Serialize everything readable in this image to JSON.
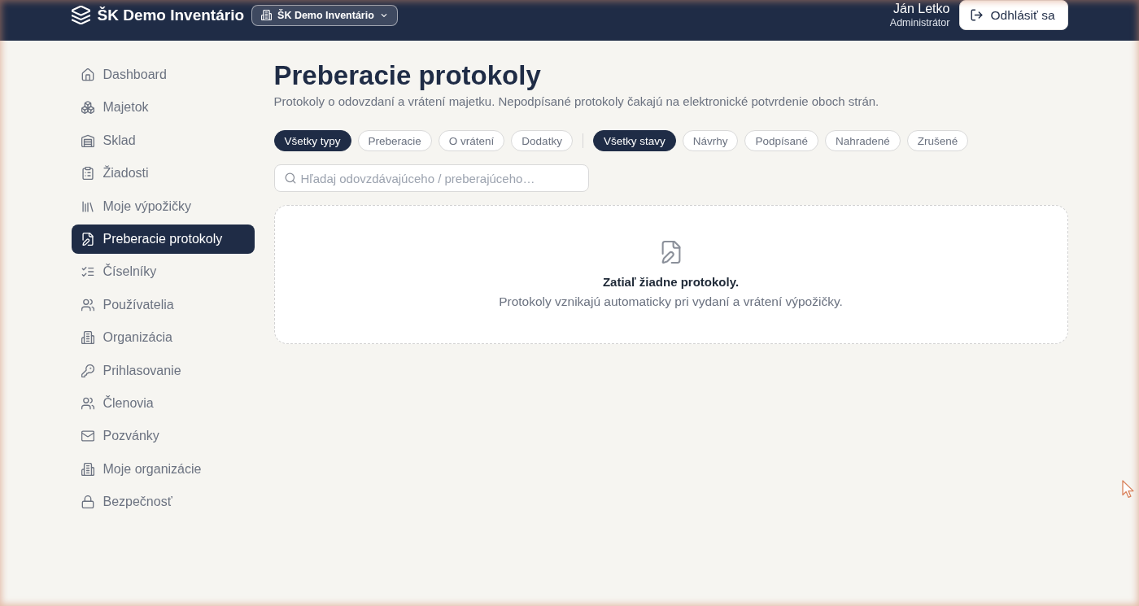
{
  "header": {
    "app_title": "ŠK Demo Inventário",
    "organization_switcher": {
      "label": "ŠK Demo Inventário"
    },
    "user": {
      "name": "Ján Letko",
      "role": "Administrátor"
    },
    "logout_button": {
      "label": "Odhlásiť sa"
    }
  },
  "sidebar": {
    "items": [
      {
        "label": "Dashboard",
        "selected": false
      },
      {
        "label": "Majetok",
        "selected": false
      },
      {
        "label": "Sklad",
        "selected": false
      },
      {
        "label": "Žiadosti",
        "selected": false
      },
      {
        "label": "Moje výpožičky",
        "selected": false
      },
      {
        "label": "Preberacie protokoly",
        "selected": true
      },
      {
        "label": "Číselníky",
        "selected": false
      },
      {
        "label": "Používatelia",
        "selected": false
      },
      {
        "label": "Organizácia",
        "selected": false
      },
      {
        "label": "Prihlasovanie",
        "selected": false
      },
      {
        "label": "Členovia",
        "selected": false
      },
      {
        "label": "Pozvánky",
        "selected": false
      },
      {
        "label": "Moje organizácie",
        "selected": false
      },
      {
        "label": "Bezpečnosť",
        "selected": false
      }
    ]
  },
  "page": {
    "title": "Preberacie protokoly",
    "subtitle": "Protokoly o odovzdaní a vrátení majetku. Nepodpísané protokoly čakajú na elektronické potvrdenie oboch strán."
  },
  "filters": {
    "type_filters": [
      {
        "label": "Všetky typy",
        "selected": true
      },
      {
        "label": "Preberacie",
        "selected": false
      },
      {
        "label": "O vrátení",
        "selected": false
      },
      {
        "label": "Dodatky",
        "selected": false
      }
    ],
    "status_filters": [
      {
        "label": "Všetky stavy",
        "selected": true
      },
      {
        "label": "Návrhy",
        "selected": false
      },
      {
        "label": "Podpísané",
        "selected": false
      },
      {
        "label": "Nahradené",
        "selected": false
      },
      {
        "label": "Zrušené",
        "selected": false
      }
    ]
  },
  "search": {
    "placeholder": "Hľadaj odovzdávajúceho / preberajúceho…"
  },
  "empty_state": {
    "title": "Zatiaľ žiadne protokoly.",
    "message": "Protokoly vznikajú automaticky pri vydaní a vrátení výpožičky."
  }
}
